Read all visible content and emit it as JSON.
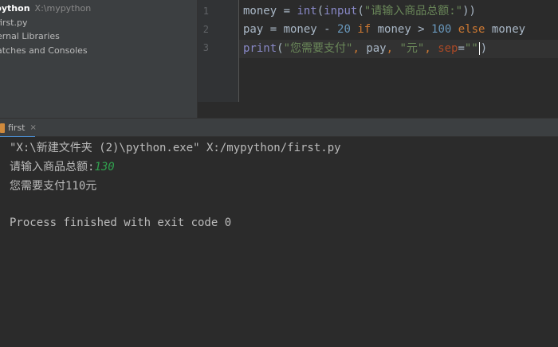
{
  "project_tree": {
    "root_name": "python",
    "root_path": "X:\\mypython",
    "items": [
      {
        "label": "first.py"
      },
      {
        "label": "ernal Libraries"
      },
      {
        "label": "atches and Consoles"
      }
    ]
  },
  "editor": {
    "line_numbers": [
      "1",
      "2",
      "3"
    ],
    "lines": [
      {
        "tokens": [
          {
            "t": "money = "
          },
          {
            "t": "int",
            "c": "bi"
          },
          {
            "t": "("
          },
          {
            "t": "input",
            "c": "bi"
          },
          {
            "t": "("
          },
          {
            "t": "\"请输入商品总额:\"",
            "c": "str"
          },
          {
            "t": "))"
          }
        ]
      },
      {
        "tokens": [
          {
            "t": "pay = money - "
          },
          {
            "t": "20",
            "c": "num"
          },
          {
            "t": " "
          },
          {
            "t": "if",
            "c": "kw"
          },
          {
            "t": " money > "
          },
          {
            "t": "100",
            "c": "num"
          },
          {
            "t": " "
          },
          {
            "t": "else",
            "c": "kw"
          },
          {
            "t": " money"
          }
        ]
      },
      {
        "tokens": [
          {
            "t": "print",
            "c": "bi"
          },
          {
            "t": "("
          },
          {
            "t": "\"您需要支付\"",
            "c": "str"
          },
          {
            "t": ", ",
            "c": "kw"
          },
          {
            "t": "pay"
          },
          {
            "t": ", ",
            "c": "kw"
          },
          {
            "t": "\"元\"",
            "c": "str"
          },
          {
            "t": ", ",
            "c": "kw"
          },
          {
            "t": "sep",
            "c": "param"
          },
          {
            "t": "="
          },
          {
            "t": "\"\"",
            "c": "str"
          },
          {
            "t": ")"
          }
        ]
      }
    ]
  },
  "run_window": {
    "tab_label": "first",
    "tab_close": "×"
  },
  "console": {
    "command": "\"X:\\新建文件夹 (2)\\python.exe\" X:/mypython/first.py",
    "prompt": "请输入商品总额:",
    "user_input": "130",
    "output": "您需要支付110元",
    "exit_message": "Process finished with exit code 0"
  },
  "colors": {
    "editor_bg": "#2b2b2b",
    "panel_bg": "#3c3f41",
    "string": "#6a8759",
    "keyword": "#cc7832",
    "number": "#6897bb",
    "input_green": "#30a14e"
  }
}
